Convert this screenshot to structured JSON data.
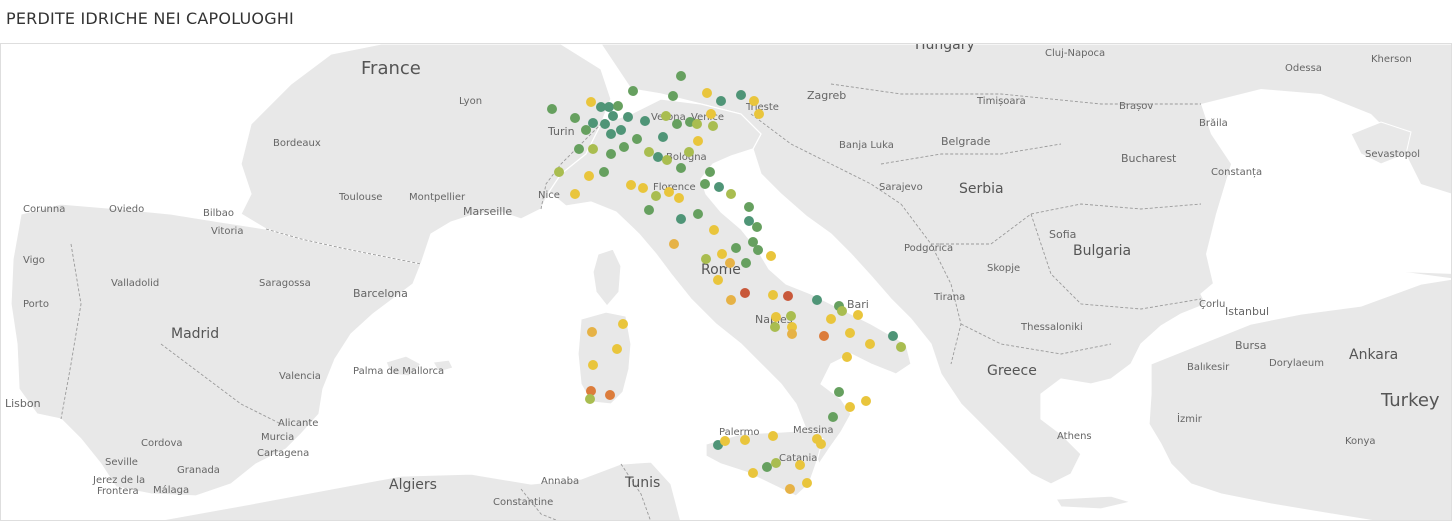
{
  "title": "PERDITE IDRICHE NEI CAPOLUOGHI",
  "colors": {
    "sea": "#ffffff",
    "land": "#e8e8e8",
    "border": "#ffffff",
    "dark_green": "#4f9577",
    "green": "#66a05f",
    "yellow_green": "#a9bd50",
    "yellow": "#e9c53c",
    "orange_yellow": "#e6b246",
    "orange": "#dc7c3b",
    "red": "#c8583a"
  },
  "labels": {
    "france": "France",
    "hungary": "Hungary",
    "lyon": "Lyon",
    "bordeaux": "Bordeaux",
    "toulouse": "Toulouse",
    "montpellier": "Montpellier",
    "marseille": "Marseille",
    "nice": "Nice",
    "turin": "Turin",
    "verona": "Verona",
    "venice": "Venice",
    "trieste": "Trieste",
    "bologna": "Bologna",
    "florence": "Florence",
    "rome": "Rome",
    "naples": "Naples",
    "bari": "Bari",
    "palermo": "Palermo",
    "messina": "Messina",
    "catania": "Catania",
    "corunna": "Corunna",
    "oviedo": "Oviedo",
    "bilbao": "Bilbao",
    "vitoria": "Vitoria",
    "vigo": "Vigo",
    "valladolid": "Valladolid",
    "saragossa": "Saragossa",
    "barcelona": "Barcelona",
    "porto": "Porto",
    "madrid": "Madrid",
    "palma": "Palma de Mallorca",
    "valencia": "Valencia",
    "lisbon": "Lisbon",
    "alicante": "Alicante",
    "murcia": "Murcia",
    "cartagena": "Cartagena",
    "cordova": "Cordova",
    "seville": "Seville",
    "granada": "Granada",
    "jerez": "Jerez de la\nFrontera",
    "malaga": "Málaga",
    "algiers": "Algiers",
    "annaba": "Annaba",
    "tunis": "Tunis",
    "constantine": "Constantine",
    "zagreb": "Zagreb",
    "banja_luka": "Banja Luka",
    "sarajevo": "Sarajevo",
    "belgrade": "Belgrade",
    "serbia": "Serbia",
    "podgorica": "Podgorica",
    "skopje": "Skopje",
    "tirana": "Tirana",
    "thessaloniki": "Thessaloniki",
    "greece": "Greece",
    "athens": "Athens",
    "cluj": "Cluj-Napoca",
    "timisoara": "Timișoara",
    "brasov": "Brașov",
    "bucharest": "Bucharest",
    "braila": "Brăila",
    "constanta": "Constanța",
    "odessa": "Odessa",
    "kherson": "Kherson",
    "sevastopol": "Sevastopol",
    "sofia": "Sofia",
    "bulgaria": "Bulgaria",
    "istanbul": "Istanbul",
    "corlu": "Çorlu",
    "bursa": "Bursa",
    "balikesir": "Balıkesir",
    "dorylaeum": "Dorylaeum",
    "ankara": "Ankara",
    "turkey": "Turkey",
    "izmir": "İzmir",
    "konya": "Konya"
  }
}
